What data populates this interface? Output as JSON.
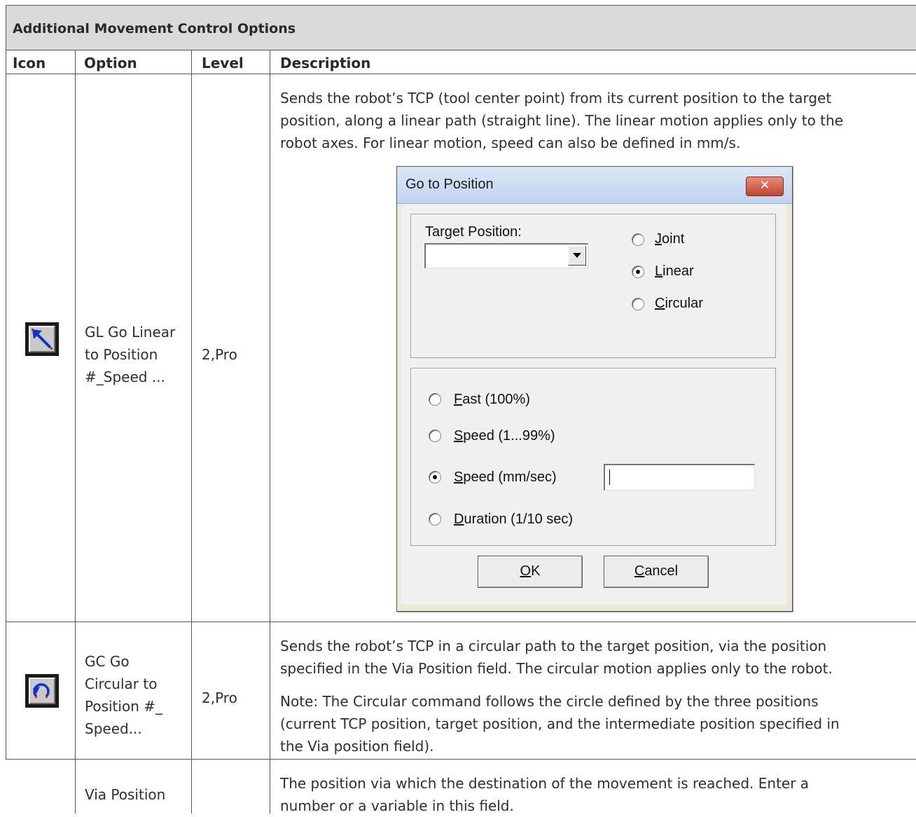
{
  "table": {
    "title": "Additional Movement Control Options",
    "headers": {
      "icon": "Icon",
      "option": "Option",
      "level": "Level",
      "description": "Description"
    },
    "rows": [
      {
        "icon": "go-linear-arrow-icon",
        "option_lines": [
          "GL Go Linear",
          "to Position",
          "#_Speed ..."
        ],
        "level": "2,Pro",
        "description": [
          "Sends the robot’s TCP (tool center point) from its current position to the target",
          "position, along a linear path (straight line). The linear motion applies only to the",
          "robot axes. For linear motion, speed can also be defined in mm/s."
        ]
      },
      {
        "icon": "go-circular-arrow-icon",
        "option_lines": [
          "GC Go",
          "Circular to",
          "Position #_",
          "Speed..."
        ],
        "level": "2,Pro",
        "description": [
          "Sends the robot’s TCP in a circular path to the target position, via the position",
          "specified in the Via Position field. The circular motion applies only to the robot."
        ],
        "note": [
          "Note: The Circular command follows the circle defined by the three positions",
          "(current TCP position, target position, and the intermediate position specified in",
          "the Via position field)."
        ]
      },
      {
        "option_lines": [
          "Via Position"
        ],
        "description": [
          "The position via which the destination of the movement is reached. Enter a",
          "number or a variable in this field."
        ]
      }
    ]
  },
  "dialog": {
    "title": "Go to Position",
    "close_label": "✕",
    "target_position_label": "Target Position:",
    "target_position_value": "",
    "motion_options": [
      {
        "label": "Joint",
        "accel": "J",
        "rest": "oint",
        "checked": false
      },
      {
        "label": "Linear",
        "accel": "L",
        "rest": "inear",
        "checked": true
      },
      {
        "label": "Circular",
        "accel": "C",
        "rest": "ircular",
        "checked": false
      }
    ],
    "speed_options": [
      {
        "label": "Fast (100%)",
        "accel": "F",
        "rest": "ast (100%)",
        "checked": false
      },
      {
        "label": "Speed (1...99%)",
        "accel": "S",
        "rest": "peed (1...99%)",
        "checked": false
      },
      {
        "label": "Speed (mm/sec)",
        "accel": "S",
        "rest": "peed (mm/sec)",
        "checked": true
      },
      {
        "label": "Duration (1/10 sec)",
        "accel": "D",
        "rest": "uration (1/10 sec)",
        "checked": false
      }
    ],
    "speed_value": "",
    "ok_label": {
      "accel": "O",
      "rest": "K"
    },
    "cancel_label": {
      "accel": "C",
      "rest": "ancel"
    }
  }
}
